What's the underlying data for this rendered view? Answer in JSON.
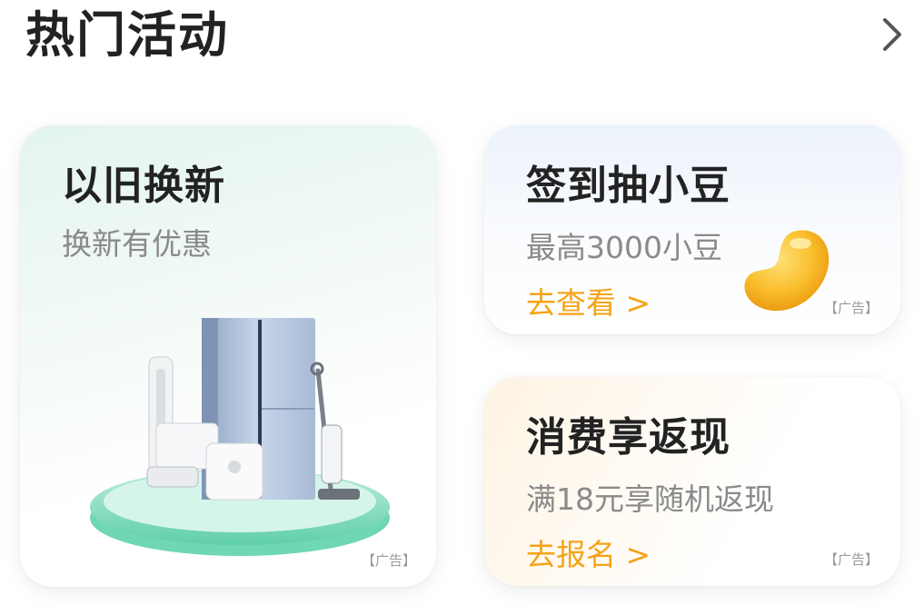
{
  "header": {
    "title": "热门活动",
    "more_icon": "chevron-right-icon"
  },
  "cards": {
    "trade_in": {
      "title": "以旧换新",
      "subtitle": "换新有优惠",
      "ad_label": "【广告】",
      "image": "home-appliances-illustration"
    },
    "checkin": {
      "title": "签到抽小豆",
      "subtitle": "最高3000小豆",
      "link_label": "去查看 >",
      "ad_label": "【广告】",
      "image": "yellow-bean-illustration"
    },
    "cashback": {
      "title": "消费享返现",
      "subtitle": "满18元享随机返现",
      "link_label": "去报名 >",
      "ad_label": "【广告】"
    }
  },
  "colors": {
    "accent": "#f5a316",
    "title_text": "#222222",
    "subtitle_text": "#8a8a8a"
  }
}
